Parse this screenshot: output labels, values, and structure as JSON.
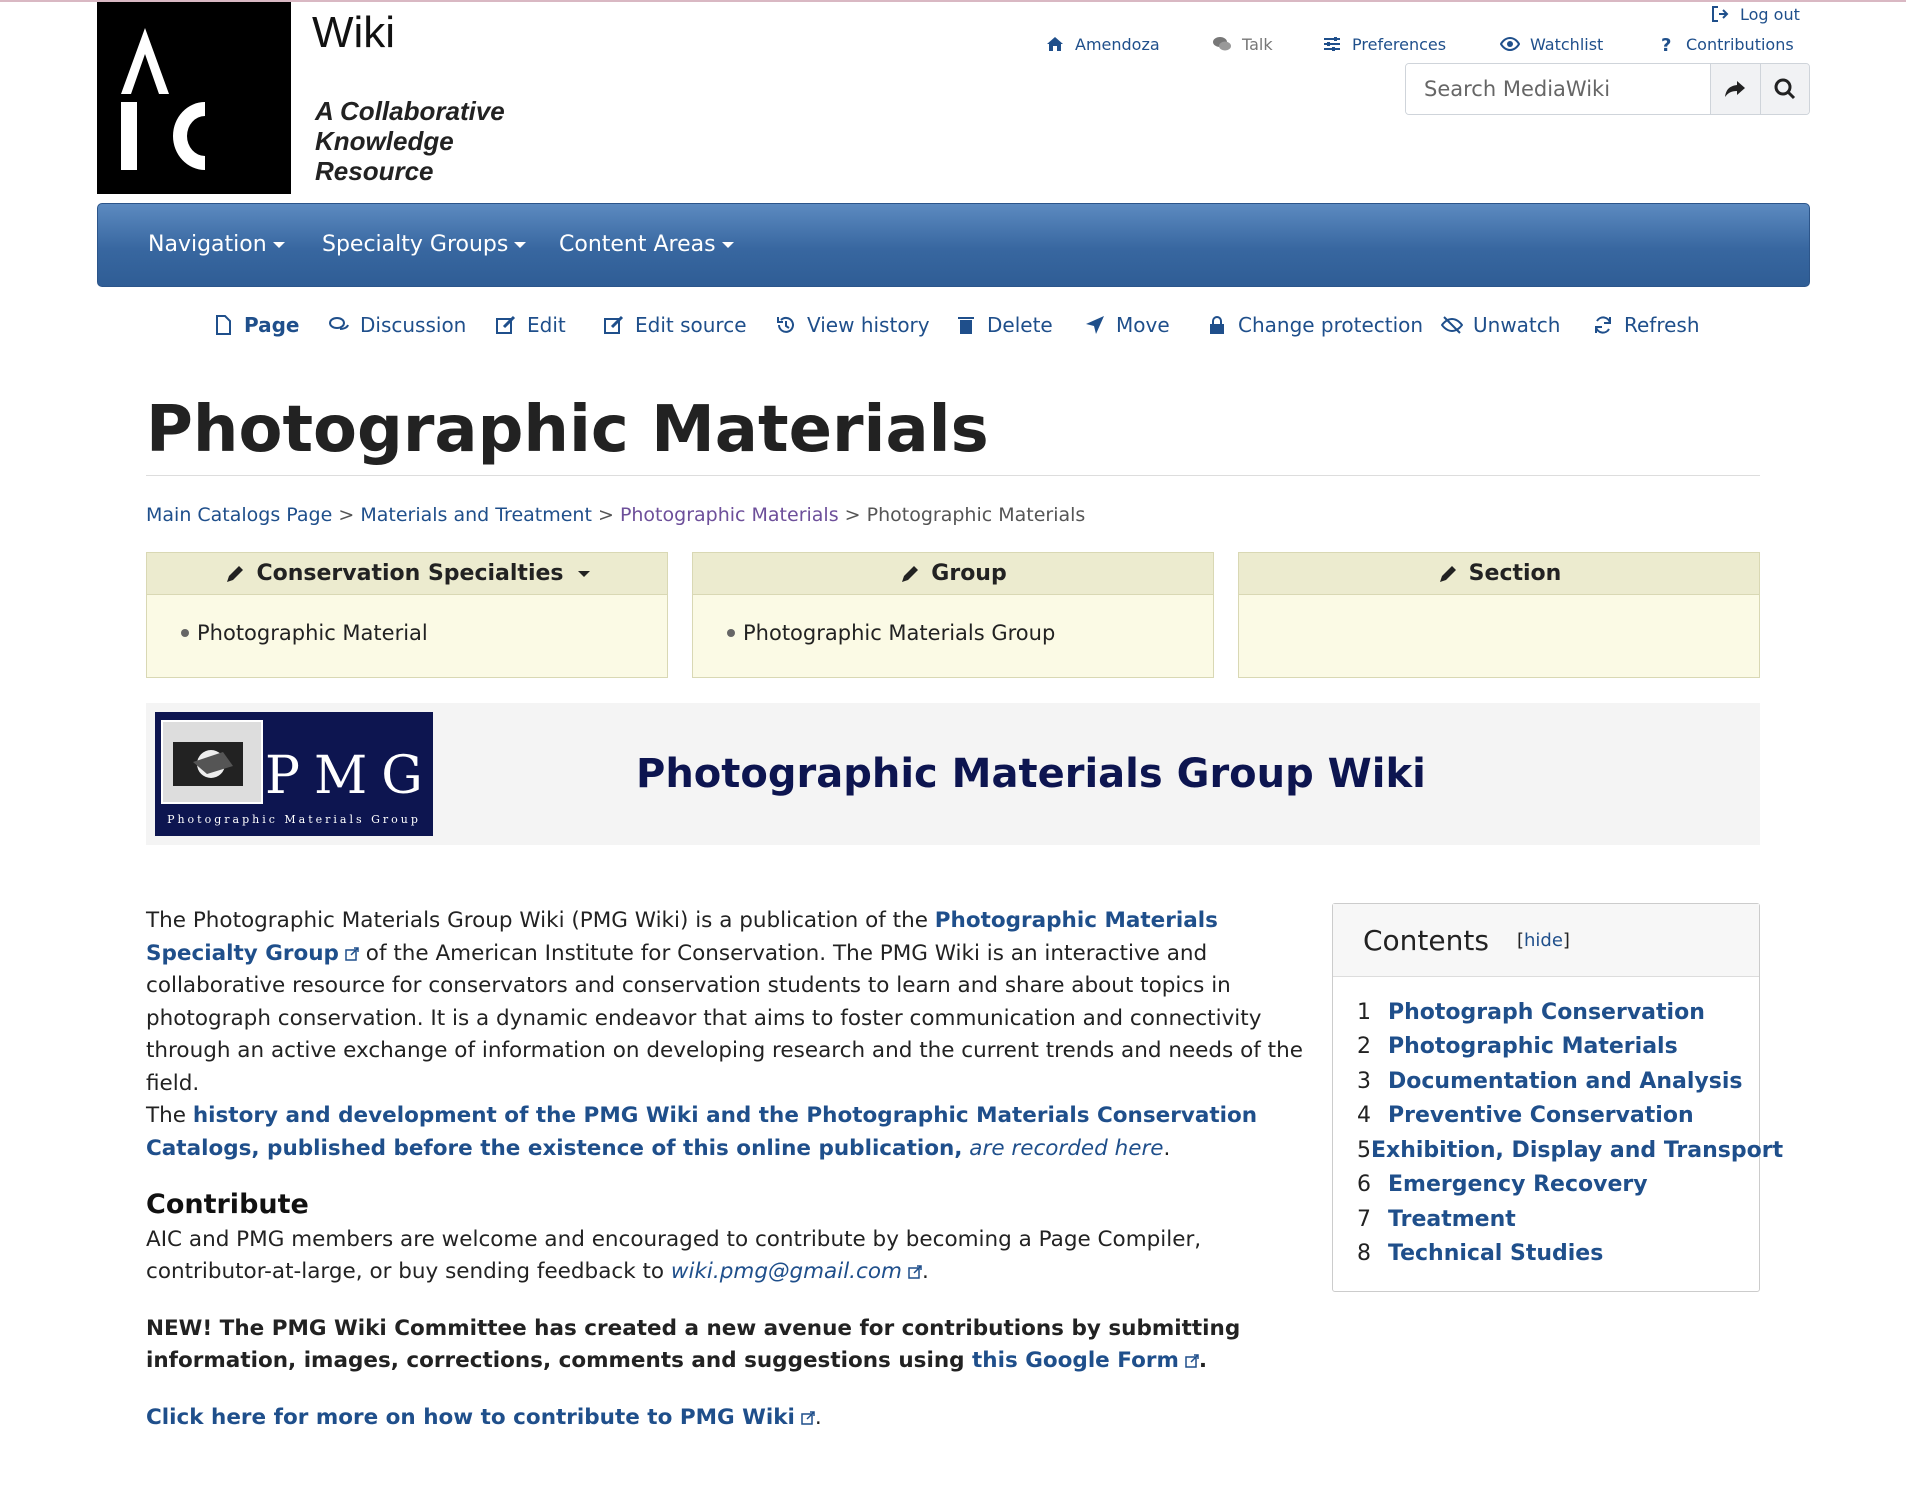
{
  "header": {
    "logo_text": "AIC",
    "brand_title": "Wiki",
    "brand_subtitle": "A Collaborative Knowledge Resource"
  },
  "user_menu": {
    "logout": "Log out",
    "user": "Amendoza",
    "talk": "Talk",
    "preferences": "Preferences",
    "watchlist": "Watchlist",
    "contributions": "Contributions"
  },
  "search": {
    "placeholder": "Search MediaWiki"
  },
  "navbar": {
    "items": [
      "Navigation",
      "Specialty Groups",
      "Content Areas"
    ]
  },
  "actions": {
    "page": "Page",
    "discussion": "Discussion",
    "edit": "Edit",
    "edit_source": "Edit source",
    "view_history": "View history",
    "delete": "Delete",
    "move": "Move",
    "change_protection": "Change protection",
    "unwatch": "Unwatch",
    "refresh": "Refresh"
  },
  "page": {
    "title": "Photographic Materials"
  },
  "breadcrumb": {
    "items": [
      "Main Catalogs Page",
      "Materials and Treatment",
      "Photographic Materials",
      "Photographic Materials"
    ],
    "separator": ">"
  },
  "boxes": [
    {
      "title": "Conservation Specialties",
      "item": "Photographic Material"
    },
    {
      "title": "Group",
      "item": "Photographic Materials Group"
    },
    {
      "title": "Section",
      "item": ""
    }
  ],
  "banner": {
    "logo_letters": "PMG",
    "logo_caption": "Photographic Materials Group",
    "title": "Photographic Materials Group Wiki"
  },
  "content": {
    "p1_a": "The Photographic Materials Group Wiki (PMG Wiki) is a publication of the ",
    "p1_link": "Photographic Materials Specialty Group",
    "p1_b": " of the American Institute for Conservation. The PMG Wiki is an interactive and collaborative resource for conservators and conservation students to learn and share about topics in photograph conservation. It is a dynamic endeavor that aims to foster communication and connectivity through an active exchange of information on developing research and the current trends and needs of the field.",
    "p2_a": "The ",
    "p2_link": "history and development of the PMG Wiki and the Photographic Materials Conservation Catalogs, published before the existence of this online publication,",
    "p2_link_italic": " are recorded here",
    "p2_end": ".",
    "contribute_heading": "Contribute",
    "p3_a": "AIC and PMG members are welcome and encouraged to contribute by becoming a Page Compiler, contributor-at-large, or buy sending feedback to ",
    "p3_email": "wiki.pmg@gmail.com",
    "p3_end": ".",
    "p4_bold": "NEW! The PMG Wiki Committee has created a new avenue for contributions by submitting information, images, corrections, comments and suggestions using ",
    "p4_link": "this Google Form",
    "p4_end": ".",
    "p5_link": "Click here for more on how to contribute to PMG Wiki",
    "p5_end": "."
  },
  "toc": {
    "title": "Contents",
    "hide": "hide",
    "items": [
      {
        "num": "1",
        "label": "Photograph Conservation"
      },
      {
        "num": "2",
        "label": "Photographic Materials"
      },
      {
        "num": "3",
        "label": "Documentation and Analysis"
      },
      {
        "num": "4",
        "label": "Preventive Conservation"
      },
      {
        "num": "5",
        "label": "Exhibition, Display and Transport"
      },
      {
        "num": "6",
        "label": "Emergency Recovery"
      },
      {
        "num": "7",
        "label": "Treatment"
      },
      {
        "num": "8",
        "label": "Technical Studies"
      }
    ]
  },
  "colors": {
    "link": "#1f4f8b",
    "navbar": "#3867a0",
    "box_head": "#ecebcf",
    "banner_title": "#0d1550"
  }
}
